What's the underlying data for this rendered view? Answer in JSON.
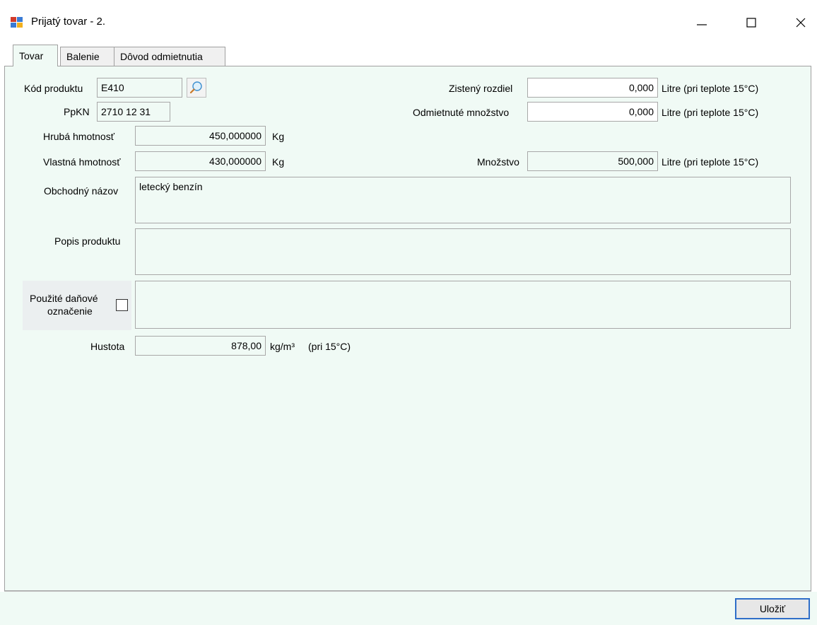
{
  "window": {
    "title": "Prijatý tovar - 2.",
    "controls": {
      "minimize": "—",
      "maximize": "☐",
      "close": "✕"
    }
  },
  "tabs": [
    {
      "label": "Tovar",
      "active": true
    },
    {
      "label": "Balenie",
      "active": false
    },
    {
      "label": "Dôvod odmietnutia",
      "active": false
    }
  ],
  "form": {
    "kod_produktu": {
      "label": "Kód produktu",
      "value": "E410"
    },
    "ppkn": {
      "label": "PpKN",
      "value": "2710 12 31"
    },
    "hruba_hmotnost": {
      "label": "Hrubá hmotnosť",
      "value": "450,000000",
      "unit": "Kg"
    },
    "vlastna_hmotnost": {
      "label": "Vlastná hmotnosť",
      "value": "430,000000",
      "unit": "Kg"
    },
    "obchodny_nazov": {
      "label": "Obchodný názov",
      "value": "letecký benzín"
    },
    "popis_produktu": {
      "label": "Popis produktu",
      "value": ""
    },
    "danove_oznacenie": {
      "label_line1": "Použité daňové",
      "label_line2": "označenie",
      "checked": false,
      "value": ""
    },
    "hustota": {
      "label": "Hustota",
      "value": "878,00",
      "unit": "kg/m³",
      "note": "(pri 15°C)"
    },
    "zisteny_rozdiel": {
      "label": "Zistený rozdiel",
      "value": "0,000",
      "unit": "Litre (pri teplote 15°C)"
    },
    "odmietnute_mnozstvo": {
      "label": "Odmietnuté množstvo",
      "value": "0,000",
      "unit": "Litre (pri teplote 15°C)"
    },
    "mnozstvo": {
      "label": "Množstvo",
      "value": "500,000",
      "unit": "Litre (pri teplote 15°C)"
    }
  },
  "footer": {
    "save_label": "Uložiť"
  },
  "icons": {
    "app": "app-window-icon",
    "search": "magnifier-icon"
  },
  "colors": {
    "panel_bg": "#f0faf5",
    "focus_border": "#2f6ec8"
  }
}
